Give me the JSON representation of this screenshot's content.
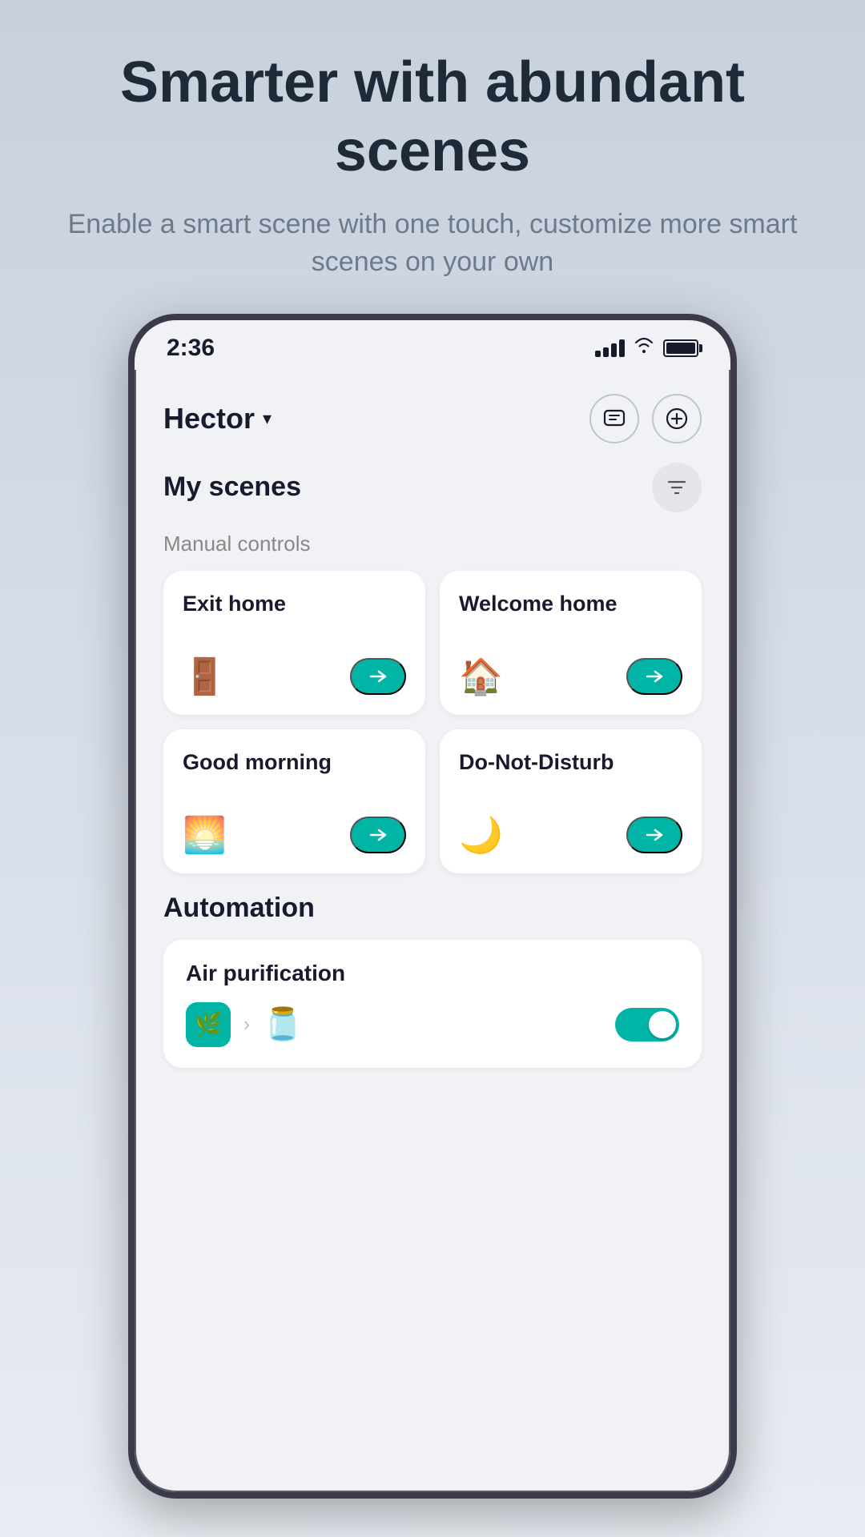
{
  "page": {
    "header": {
      "title": "Smarter with abundant scenes",
      "subtitle": "Enable a smart scene with one touch, customize more smart scenes on your own"
    },
    "statusBar": {
      "time": "2:36"
    },
    "nav": {
      "locationName": "Hector",
      "chevronLabel": "▾"
    },
    "myScenesSection": {
      "label": "My scenes",
      "filterIcon": "filter"
    },
    "manualControls": {
      "label": "Manual controls",
      "cards": [
        {
          "title": "Exit home",
          "icon": "🚪",
          "runLabel": "▶"
        },
        {
          "title": "Welcome home",
          "icon": "🏠",
          "runLabel": "▶"
        },
        {
          "title": "Good morning",
          "icon": "🌅",
          "runLabel": "▶"
        },
        {
          "title": "Do-Not-Disturb",
          "icon": "🌙",
          "runLabel": "▶"
        }
      ]
    },
    "automation": {
      "label": "Automation",
      "items": [
        {
          "name": "Air purification",
          "enabled": true
        }
      ]
    }
  }
}
